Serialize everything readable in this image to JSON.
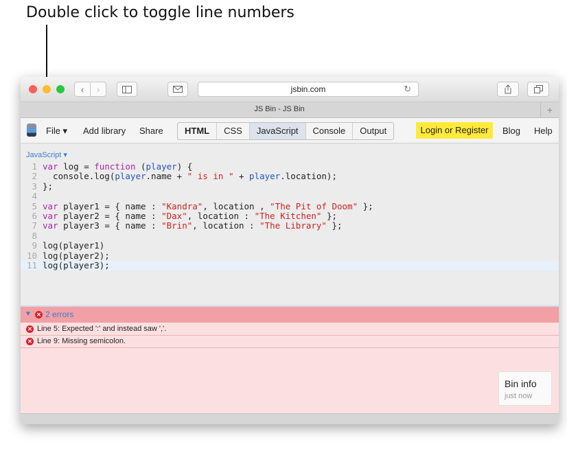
{
  "callout": {
    "text": "Double click to toggle line numbers"
  },
  "browser": {
    "address": "jsbin.com",
    "tab_title": "JS Bin - JS Bin",
    "new_tab_symbol": "+"
  },
  "jsbin": {
    "menu": {
      "file": "File ▾",
      "add_library": "Add library",
      "share": "Share"
    },
    "panels": [
      "HTML",
      "CSS",
      "JavaScript",
      "Console",
      "Output"
    ],
    "active_panel": "JavaScript",
    "login": "Login or Register",
    "blog": "Blog",
    "help": "Help",
    "panel_label": "JavaScript ▾"
  },
  "editor": {
    "lines": [
      {
        "n": "1",
        "tokens": [
          [
            "kw",
            "var "
          ],
          [
            "plain",
            "log = "
          ],
          [
            "kw",
            "function "
          ],
          [
            "plain",
            "("
          ],
          [
            "var",
            "player"
          ],
          [
            "plain",
            ") {"
          ]
        ]
      },
      {
        "n": "2",
        "tokens": [
          [
            "plain",
            "  console.log("
          ],
          [
            "var",
            "player"
          ],
          [
            "plain",
            ".name + "
          ],
          [
            "str",
            "\" is in \""
          ],
          [
            "plain",
            " + "
          ],
          [
            "var",
            "player"
          ],
          [
            "plain",
            ".location);"
          ]
        ]
      },
      {
        "n": "3",
        "tokens": [
          [
            "plain",
            "};"
          ]
        ]
      },
      {
        "n": "4",
        "tokens": []
      },
      {
        "n": "5",
        "tokens": [
          [
            "kw",
            "var "
          ],
          [
            "plain",
            "player1 = { name : "
          ],
          [
            "str",
            "\"Kandra\""
          ],
          [
            "plain",
            ", location , "
          ],
          [
            "str",
            "\"The Pit of Doom\""
          ],
          [
            "plain",
            " };"
          ]
        ]
      },
      {
        "n": "6",
        "tokens": [
          [
            "kw",
            "var "
          ],
          [
            "plain",
            "player2 = { name : "
          ],
          [
            "str",
            "\"Dax\""
          ],
          [
            "plain",
            ", location : "
          ],
          [
            "str",
            "\"The Kitchen\""
          ],
          [
            "plain",
            " };"
          ]
        ]
      },
      {
        "n": "7",
        "tokens": [
          [
            "kw",
            "var "
          ],
          [
            "plain",
            "player3 = { name : "
          ],
          [
            "str",
            "\"Brin\""
          ],
          [
            "plain",
            ", location : "
          ],
          [
            "str",
            "\"The Library\""
          ],
          [
            "plain",
            " };"
          ]
        ]
      },
      {
        "n": "8",
        "tokens": []
      },
      {
        "n": "9",
        "tokens": [
          [
            "plain",
            "log(player1)"
          ]
        ]
      },
      {
        "n": "10",
        "tokens": [
          [
            "plain",
            "log(player2);"
          ]
        ]
      },
      {
        "n": "11",
        "tokens": [
          [
            "plain",
            "log(player3);"
          ]
        ]
      }
    ],
    "current_line": "11"
  },
  "errors": {
    "arrow": "▼",
    "icon": "✕",
    "count_label": "2 errors",
    "items": [
      "Line 5: Expected ':' and instead saw ','.",
      "Line 9: Missing semicolon."
    ]
  },
  "bin_info": {
    "title": "Bin info",
    "subtitle": "just now"
  }
}
